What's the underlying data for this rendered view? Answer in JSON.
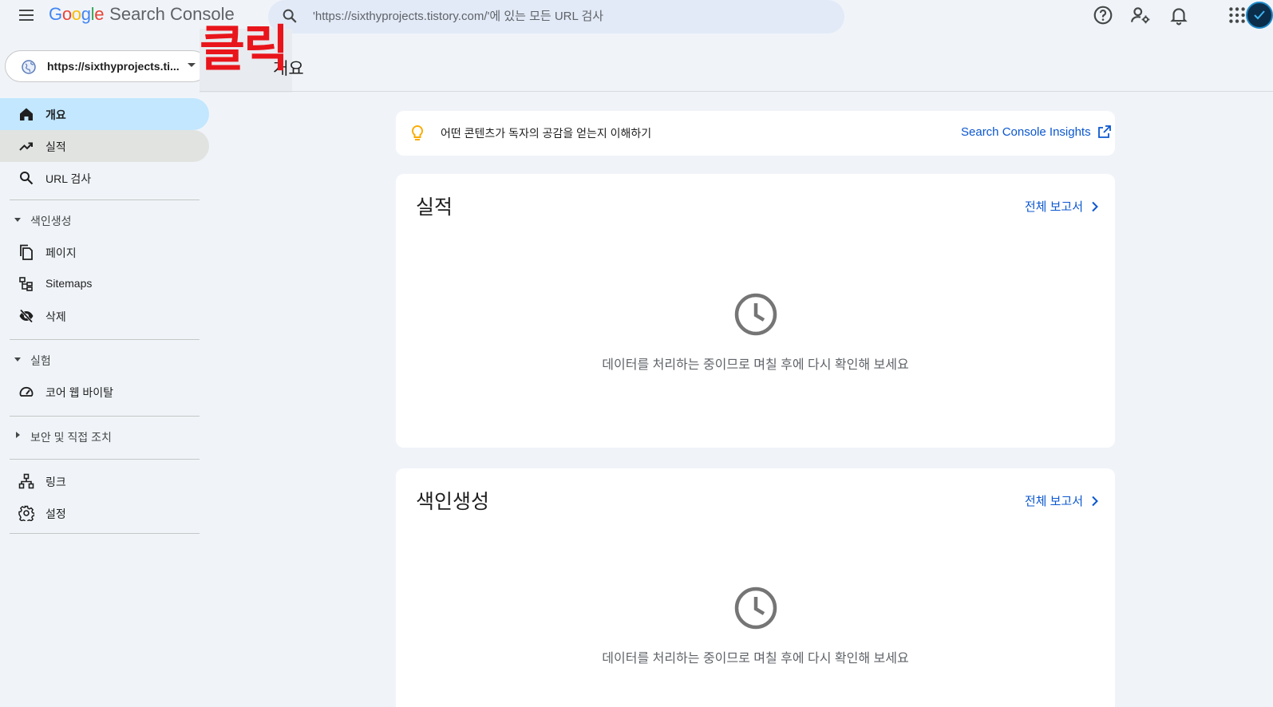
{
  "header": {
    "logo_google": [
      "G",
      "o",
      "o",
      "g",
      "l",
      "e"
    ],
    "logo_colors": [
      "#4285f4",
      "#ea4335",
      "#fbbc05",
      "#4285f4",
      "#34a853",
      "#ea4335"
    ],
    "product_name": "Search Console",
    "search_placeholder": "'https://sixthyprojects.tistory.com/'에 있는 모든 URL 검사",
    "icons": [
      "menu-icon",
      "search-icon",
      "help-icon",
      "manage-users-icon",
      "notifications-icon",
      "apps-grid-icon",
      "avatar"
    ]
  },
  "property": {
    "label": "https://sixthyprojects.ti..."
  },
  "annotation": {
    "click_label": "클릭"
  },
  "page": {
    "title": "개요"
  },
  "sidebar": {
    "items": [
      {
        "label": "개요",
        "icon": "home-icon"
      },
      {
        "label": "실적",
        "icon": "trending-up-icon"
      },
      {
        "label": "URL 검사",
        "icon": "search-icon"
      }
    ],
    "sections": [
      {
        "label": "색인생성",
        "items": [
          {
            "label": "페이지",
            "icon": "pages-icon"
          },
          {
            "label": "Sitemaps",
            "icon": "sitemap-icon"
          },
          {
            "label": "삭제",
            "icon": "visibility-off-icon"
          }
        ]
      },
      {
        "label": "실험",
        "items": [
          {
            "label": "코어 웹 바이탈",
            "icon": "speed-icon"
          }
        ]
      },
      {
        "label": "보안 및 직접 조치"
      }
    ],
    "bottom_items": [
      {
        "label": "링크",
        "icon": "links-icon"
      },
      {
        "label": "설정",
        "icon": "settings-icon"
      }
    ]
  },
  "insight": {
    "text": "어떤 콘텐츠가 독자의 공감을 얻는지 이해하기",
    "link": "Search Console Insights"
  },
  "cards": [
    {
      "title": "실적",
      "link": "전체 보고서",
      "message": "데이터를 처리하는 중이므로 며칠 후에 다시 확인해 보세요"
    },
    {
      "title": "색인생성",
      "link": "전체 보고서",
      "message": "데이터를 처리하는 중이므로 며칠 후에 다시 확인해 보세요"
    }
  ]
}
